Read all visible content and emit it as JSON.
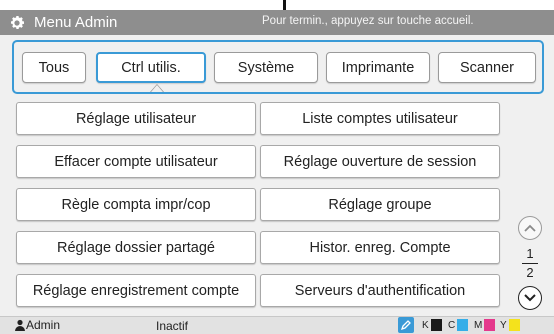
{
  "header": {
    "title": "Menu Admin",
    "message": "Pour termin., appuyez sur touche accueil.",
    "bg_color": "#8e8e8e"
  },
  "tabs": [
    {
      "label": "Tous",
      "active": false
    },
    {
      "label": "Ctrl utilis.",
      "active": true
    },
    {
      "label": "Système",
      "active": false
    },
    {
      "label": "Imprimante",
      "active": false
    },
    {
      "label": "Scanner",
      "active": false
    }
  ],
  "menu_items": [
    {
      "label": "Réglage utilisateur"
    },
    {
      "label": "Liste comptes utilisateur"
    },
    {
      "label": "Effacer compte utilisateur"
    },
    {
      "label": "Réglage ouverture de session"
    },
    {
      "label": "Règle compta impr/cop"
    },
    {
      "label": "Réglage groupe"
    },
    {
      "label": "Réglage dossier partagé"
    },
    {
      "label": "Histor. enreg. Compte"
    },
    {
      "label": "Réglage enregistrement compte"
    },
    {
      "label": "Serveurs d'authentification"
    }
  ],
  "pager": {
    "current": "1",
    "total": "2",
    "up_icon": "chevron-up-icon",
    "down_icon": "chevron-down-icon"
  },
  "status_bar": {
    "user": "Admin",
    "state": "Inactif",
    "ink": [
      {
        "label": "K",
        "color": "#1a1a1a"
      },
      {
        "label": "C",
        "color": "#35aee8"
      },
      {
        "label": "M",
        "color": "#e4398c"
      },
      {
        "label": "Y",
        "color": "#f4e21c"
      }
    ]
  },
  "colors": {
    "accent": "#3a9ad6",
    "background": "#f0f0f0"
  }
}
